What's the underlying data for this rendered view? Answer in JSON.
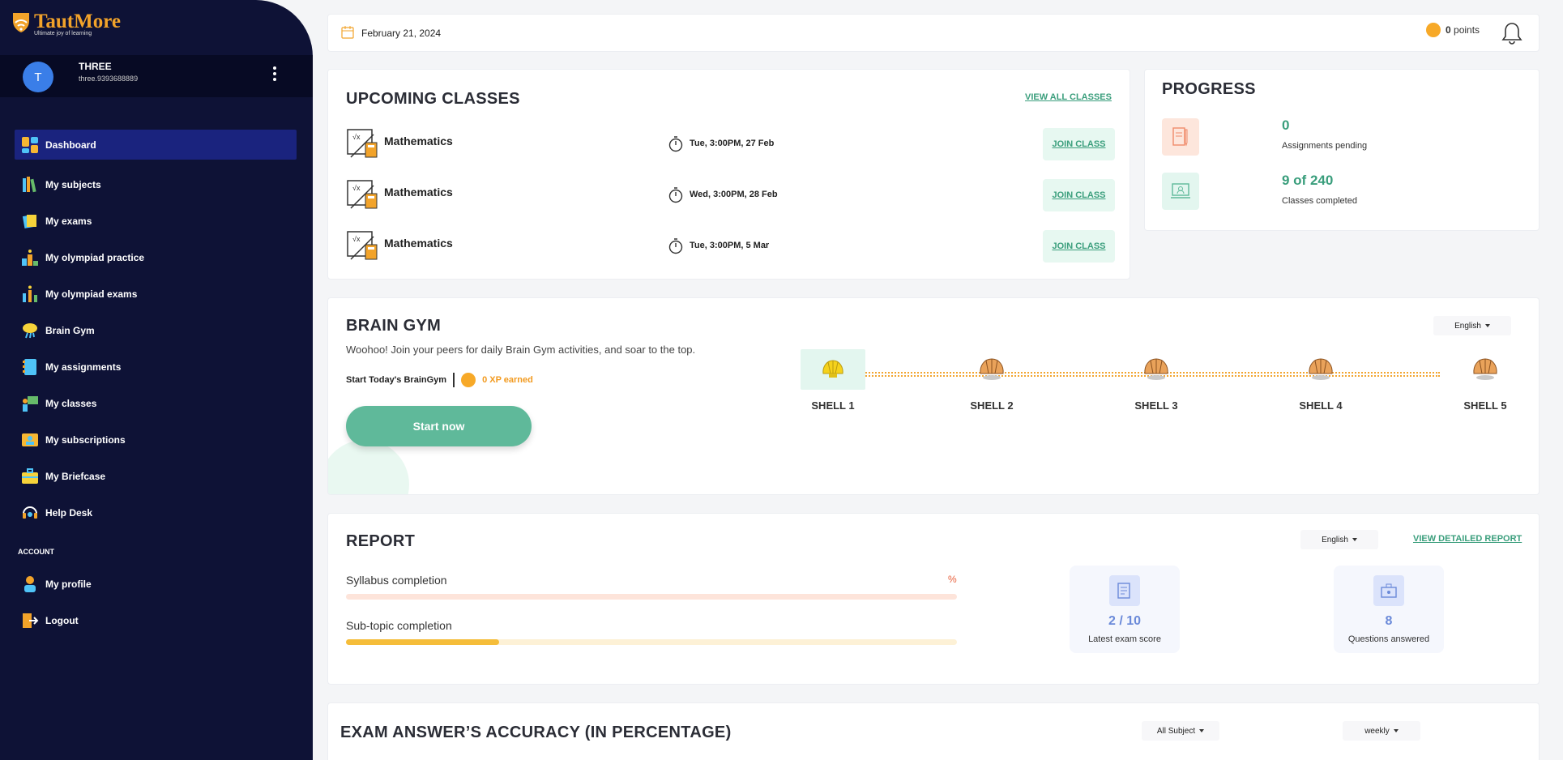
{
  "sidebar": {
    "brand": "TautMore",
    "tagline": "Ultimate joy of learning",
    "user": {
      "initial": "T",
      "name": "THREE",
      "phone": "three.9393688889"
    },
    "items": [
      {
        "label": "Dashboard",
        "icon": "dashboard-icon",
        "active": true
      },
      {
        "label": "My subjects",
        "icon": "books-icon"
      },
      {
        "label": "My exams",
        "icon": "exam-papers-icon"
      },
      {
        "label": "My olympiad practice",
        "icon": "podium-icon"
      },
      {
        "label": "My olympiad exams",
        "icon": "trophy-icon"
      },
      {
        "label": "Brain Gym",
        "icon": "brain-cloud-icon"
      },
      {
        "label": "My assignments",
        "icon": "notebook-icon"
      },
      {
        "label": "My classes",
        "icon": "teacher-board-icon"
      },
      {
        "label": "My subscriptions",
        "icon": "subscription-icon"
      },
      {
        "label": "My Briefcase",
        "icon": "briefcase-icon"
      },
      {
        "label": "Help Desk",
        "icon": "headset-icon"
      }
    ],
    "account_heading": "ACCOUNT",
    "account_items": [
      {
        "label": "My profile",
        "icon": "profile-icon"
      },
      {
        "label": "Logout",
        "icon": "logout-icon"
      }
    ]
  },
  "header": {
    "date": "February 21, 2024",
    "points_value": "0",
    "points_label": "points"
  },
  "upcoming": {
    "title": "UPCOMING CLASSES",
    "view_all": "VIEW ALL CLASSES",
    "join_label": "JOIN CLASS",
    "classes": [
      {
        "subject": "Mathematics",
        "when": "Tue, 3:00PM, 27 Feb"
      },
      {
        "subject": "Mathematics",
        "when": "Wed, 3:00PM, 28 Feb"
      },
      {
        "subject": "Mathematics",
        "when": "Tue, 3:00PM, 5 Mar"
      }
    ]
  },
  "progress": {
    "title": "PROGRESS",
    "assignments_value": "0",
    "assignments_label": "Assignments pending",
    "classes_value": "9 of 240",
    "classes_label": "Classes completed"
  },
  "brain_gym": {
    "title": "BRAIN GYM",
    "description": "Woohoo! Join your peers for daily Brain Gym activities, and soar to the top.",
    "start_label": "Start Today's BrainGym",
    "xp_text": "0 XP earned",
    "button": "Start now",
    "language": "English",
    "shells": [
      "SHELL 1",
      "SHELL 2",
      "SHELL 3",
      "SHELL 4",
      "SHELL 5"
    ]
  },
  "report": {
    "title": "REPORT",
    "language": "English",
    "view_detailed": "VIEW DETAILED REPORT",
    "syllabus_label": "Syllabus completion",
    "syllabus_value": "%",
    "subtopic_label": "Sub-topic completion",
    "subtopic_fraction": 0.25,
    "exam_score": "2 / 10",
    "exam_score_label": "Latest exam score",
    "questions": "8",
    "questions_label": "Questions answered"
  },
  "accuracy": {
    "title": "EXAM ANSWER’S ACCURACY (IN PERCENTAGE)",
    "subject_filter": "All Subject",
    "period_filter": "weekly"
  },
  "colors": {
    "sidebar": "#0e1236",
    "accent_green": "#3a9e7c",
    "button_green": "#5fb99a",
    "coin": "#f7a928",
    "stat_blue": "#6b8ad9"
  }
}
